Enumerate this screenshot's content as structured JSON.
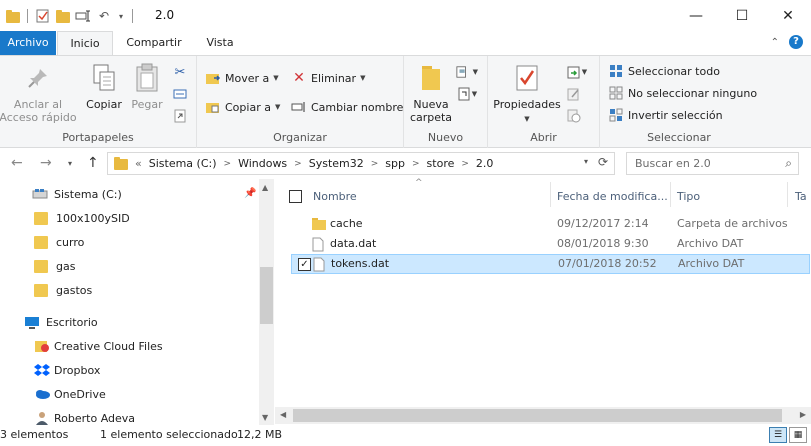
{
  "window": {
    "title": "2.0",
    "minimize": "—",
    "maximize": "☐",
    "close": "✕"
  },
  "tabs": {
    "file": "Archivo",
    "home": "Inicio",
    "share": "Compartir",
    "view": "Vista",
    "collapse": "⌃",
    "help": "?"
  },
  "ribbon": {
    "clipboard": {
      "label": "Portapapeles",
      "pin": "Anclar al\nAcceso rápido",
      "copy": "Copiar",
      "paste": "Pegar"
    },
    "organize": {
      "label": "Organizar",
      "move": "Mover a",
      "copy_to": "Copiar a",
      "delete": "Eliminar",
      "rename": "Cambiar nombre"
    },
    "new": {
      "label": "Nuevo",
      "new_folder": "Nueva\ncarpeta"
    },
    "open": {
      "label": "Abrir",
      "properties": "Propiedades"
    },
    "select": {
      "label": "Seleccionar",
      "select_all": "Seleccionar todo",
      "select_none": "No seleccionar ninguno",
      "invert": "Invertir selección"
    }
  },
  "address": {
    "overflow": "«",
    "crumbs": [
      "Sistema (C:)",
      "Windows",
      "System32",
      "spp",
      "store",
      "2.0"
    ],
    "search_placeholder": "Buscar en 2.0"
  },
  "nav_tree": [
    {
      "label": "Sistema (C:)",
      "icon": "drive-icon"
    },
    {
      "label": "100x100ySID",
      "icon": "folder-icon"
    },
    {
      "label": "curro",
      "icon": "folder-icon"
    },
    {
      "label": "gas",
      "icon": "folder-icon"
    },
    {
      "label": "gastos",
      "icon": "folder-icon"
    },
    {
      "label": "Escritorio",
      "icon": "desktop-icon"
    },
    {
      "label": "Creative Cloud Files",
      "icon": "creative-cloud-icon"
    },
    {
      "label": "Dropbox",
      "icon": "dropbox-icon"
    },
    {
      "label": "OneDrive",
      "icon": "onedrive-icon"
    },
    {
      "label": "Roberto Adeva",
      "icon": "user-icon"
    }
  ],
  "columns": {
    "name": "Nombre",
    "date": "Fecha de modifica...",
    "type": "Tipo",
    "size": "Ta"
  },
  "files": [
    {
      "name": "cache",
      "date": "09/12/2017 2:14",
      "type": "Carpeta de archivos",
      "icon": "folder-icon",
      "selected": false
    },
    {
      "name": "data.dat",
      "date": "08/01/2018 9:30",
      "type": "Archivo DAT",
      "icon": "file-icon",
      "selected": false
    },
    {
      "name": "tokens.dat",
      "date": "07/01/2018 20:52",
      "type": "Archivo DAT",
      "icon": "file-icon",
      "selected": true
    }
  ],
  "status": {
    "count": "3 elementos",
    "selection": "1 elemento seleccionado",
    "size": "12,2 MB"
  },
  "colors": {
    "accent": "#1979ca",
    "selected_row": "#cce8ff",
    "folder": "#f0c850"
  }
}
